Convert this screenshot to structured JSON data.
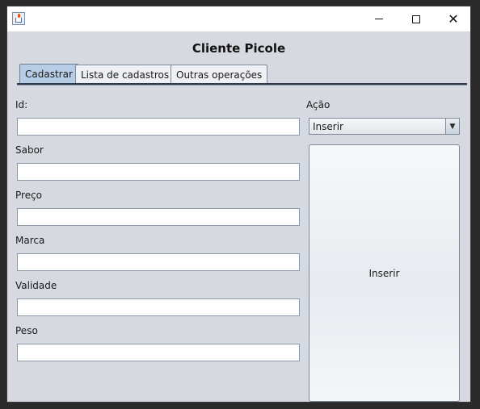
{
  "window": {
    "icon": "java-cup-icon",
    "controls": {
      "minimize": "minimize-icon",
      "maximize": "maximize-icon",
      "close": "✕"
    }
  },
  "header": {
    "title": "Cliente Picole"
  },
  "tabs": [
    {
      "label": "Cadastrar",
      "active": true
    },
    {
      "label": "Lista de cadastros",
      "active": false
    },
    {
      "label": "Outras operações",
      "active": false
    }
  ],
  "form": {
    "fields": [
      {
        "label": "Id:",
        "value": ""
      },
      {
        "label": "Sabor",
        "value": ""
      },
      {
        "label": "Preço",
        "value": ""
      },
      {
        "label": "Marca",
        "value": ""
      },
      {
        "label": "Validade",
        "value": ""
      },
      {
        "label": "Peso",
        "value": ""
      }
    ]
  },
  "action": {
    "label": "Ação",
    "selected": "Inserir",
    "button_label": "Inserir"
  },
  "colors": {
    "window_bg": "#d6d9df",
    "active_tab": "#b7cde6"
  }
}
